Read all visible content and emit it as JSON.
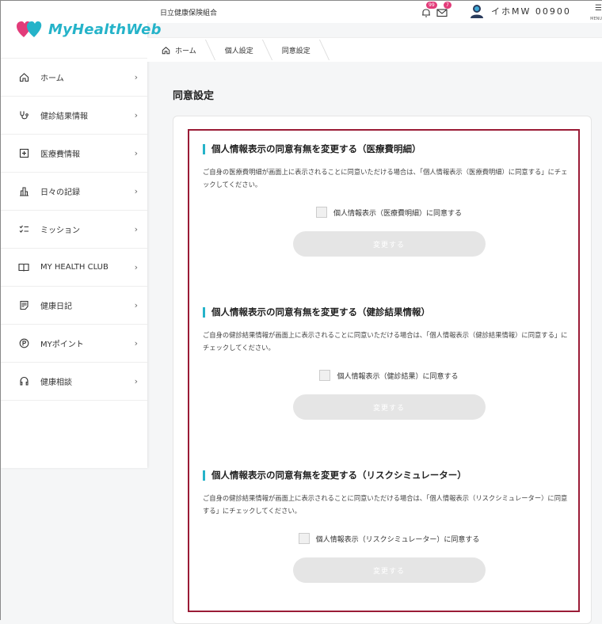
{
  "brand": {
    "logo_text": "MyHealthWeb"
  },
  "header": {
    "org": "日立健康保険組合",
    "bell_badge": "99",
    "mail_badge": "7",
    "user_name": "イホMW 00900",
    "menu_label": "MENU"
  },
  "breadcrumb": [
    "ホーム",
    "個人設定",
    "同意設定"
  ],
  "sidebar": {
    "items": [
      {
        "label": "ホーム",
        "icon": "home-icon"
      },
      {
        "label": "健診結果情報",
        "icon": "stethoscope-icon"
      },
      {
        "label": "医療費情報",
        "icon": "medical-plus-icon"
      },
      {
        "label": "日々の記録",
        "icon": "bar-chart-icon"
      },
      {
        "label": "ミッション",
        "icon": "checklist-icon"
      },
      {
        "label": "MY HEALTH CLUB",
        "icon": "book-icon"
      },
      {
        "label": "健康日記",
        "icon": "diary-icon"
      },
      {
        "label": "MYポイント",
        "icon": "point-icon"
      },
      {
        "label": "健康相談",
        "icon": "headset-icon"
      }
    ]
  },
  "page": {
    "title": "同意設定"
  },
  "sections": [
    {
      "title": "個人情報表示の同意有無を変更する（医療費明細）",
      "description": "ご自身の医療費明細が画面上に表示されることに同意いただける場合は、「個人情報表示（医療費明細）に同意する」にチェックしてください。",
      "checkbox_label": "個人情報表示（医療費明細）に同意する",
      "button_label": "変更する"
    },
    {
      "title": "個人情報表示の同意有無を変更する（健診結果情報）",
      "description": "ご自身の健診結果情報が画面上に表示されることに同意いただける場合は、「個人情報表示（健診結果情報）に同意する」にチェックしてください。",
      "checkbox_label": "個人情報表示（健診結果）に同意する",
      "button_label": "変更する"
    },
    {
      "title": "個人情報表示の同意有無を変更する（リスクシミュレーター）",
      "description": "ご自身の健診結果情報が画面上に表示されることに同意いただける場合は、「個人情報表示（リスクシミュレーター）に同意する」にチェックしてください。",
      "checkbox_label": "個人情報表示（リスクシミュレーター）に同意する",
      "button_label": "変更する"
    }
  ],
  "colors": {
    "accent": "#25b3c9",
    "highlight": "#9a1b36",
    "badge": "#e23c7a",
    "button_disabled": "#e5e5e5"
  }
}
